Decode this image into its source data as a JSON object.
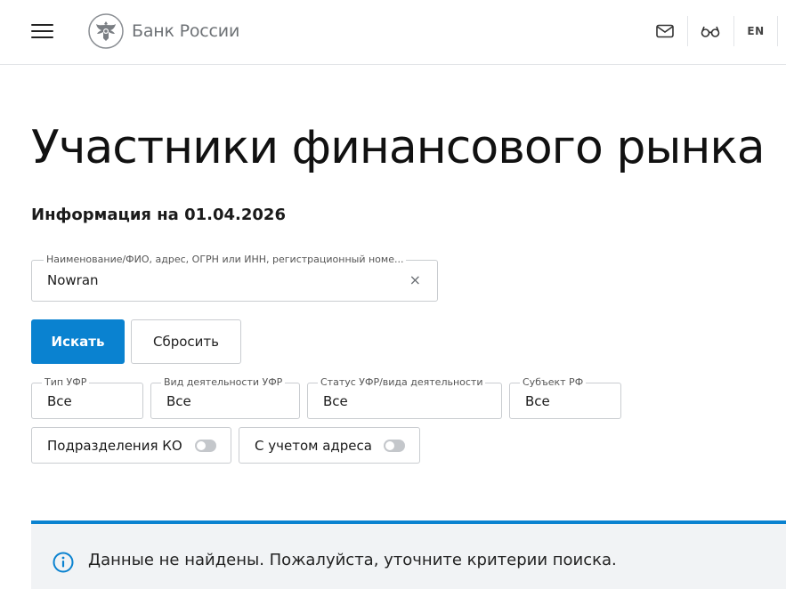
{
  "header": {
    "logo_text": "Банк России",
    "lang_label": "EN",
    "icons": [
      "menu-icon",
      "emblem-icon",
      "mail-icon",
      "glasses-icon"
    ]
  },
  "main": {
    "title": "Участники финансового рынка",
    "info_date": "Информация на 01.04.2026"
  },
  "search": {
    "label": "Наименование/ФИО, адрес, ОГРН или ИНН, регистрационный номе...",
    "value": "Nowran",
    "clear_symbol": "×"
  },
  "buttons": {
    "search_label": "Искать",
    "reset_label": "Сбросить"
  },
  "filters": [
    {
      "label": "Тип УФР",
      "value": "Все"
    },
    {
      "label": "Вид деятельности УФР",
      "value": "Все"
    },
    {
      "label": "Статус УФР/вида деятельности",
      "value": "Все"
    },
    {
      "label": "Субъект РФ",
      "value": "Все"
    }
  ],
  "toggles": [
    {
      "label": "Подразделения КО",
      "on": false
    },
    {
      "label": "С учетом адреса",
      "on": false
    }
  ],
  "notice": {
    "text": "Данные не найдены. Пожалуйста, уточните критерии поиска."
  },
  "colors": {
    "accent": "#0a82d0",
    "border": "#c9ccd0",
    "notice_bg": "#f1f3f5"
  }
}
